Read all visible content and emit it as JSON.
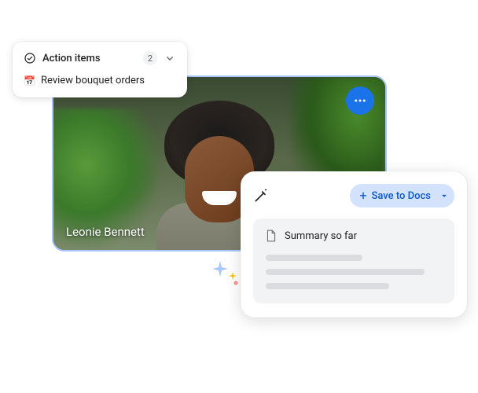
{
  "video": {
    "participant_name": "Leonie Bennett"
  },
  "action_items": {
    "title": "Action items",
    "count": "2",
    "items": [
      {
        "icon": "📅",
        "text": "Review bouquet orders"
      }
    ]
  },
  "summary": {
    "save_button_label": "Save to Docs",
    "title": "Summary so far"
  }
}
